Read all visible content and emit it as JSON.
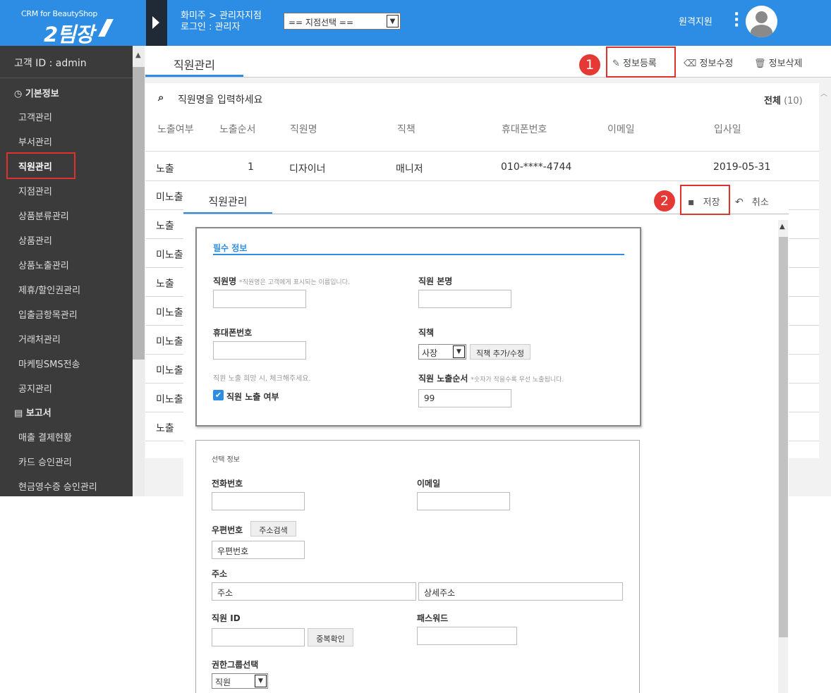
{
  "header": {
    "logo_top": "CRM for BeautyShop",
    "logo_main": "2팀장",
    "shop_line1": "화미주 > 관리자지점",
    "shop_line2": "로그인 : 관리자",
    "branch_select": "== 지점선택 ==",
    "remote_support": "원격지원"
  },
  "sidebar": {
    "customer_id": "고객 ID : admin",
    "sections": [
      {
        "title": "기본정보",
        "items": [
          "고객관리",
          "부서관리",
          "직원관리",
          "지점관리",
          "상품분류관리",
          "상품관리",
          "상품노출관리",
          "제휴/할인권관리",
          "입출금항목관리",
          "거래처관리",
          "마케팅SMS전송",
          "공지관리"
        ]
      },
      {
        "title": "보고서",
        "items": [
          "매출 결제현황",
          "카드 승인관리",
          "현금영수증 승인관리"
        ]
      }
    ],
    "active_item": "직원관리"
  },
  "main": {
    "tab": "직원관리",
    "toolbar": {
      "register": "정보등록",
      "edit": "정보수정",
      "delete": "정보삭제"
    },
    "search_placeholder": "직원명을 입력하세요",
    "total_label": "전체",
    "total_count": "(10)",
    "columns": [
      "노출여부",
      "노출순서",
      "직원명",
      "직책",
      "휴대폰번호",
      "이메일",
      "입사일"
    ],
    "first_row": {
      "exposure": "노출",
      "order": "1",
      "name": "디자이너",
      "position": "매니저",
      "phone": "010-****-4744",
      "email": "",
      "joined": "2019-05-31"
    },
    "exposure_column": [
      "미노출",
      "노출",
      "미노출",
      "노출",
      "미노출",
      "미노출",
      "미노출",
      "미노출",
      "노출"
    ]
  },
  "modal": {
    "tab": "직원관리",
    "save": "저장",
    "cancel": "취소",
    "required": {
      "title": "필수 정보",
      "name_label": "직원명",
      "name_hint": "*직원명은 고객에게 표시되는 이름입니다.",
      "realname_label": "직원 본명",
      "phone_label": "휴대폰번호",
      "position_label": "직책",
      "position_value": "사장",
      "position_btn": "직책 추가/수정",
      "expose_hint": "직원 노출 희망 시, 체크해주세요.",
      "expose_label": "직원 노출 여부",
      "order_label": "직원 노출순서",
      "order_hint": "*숫자가 작을수록 우선 노출됩니다.",
      "order_value": "99"
    },
    "optional": {
      "title": "선택 정보",
      "tel_label": "전화번호",
      "email_label": "이메일",
      "zip_label": "우편번호",
      "zip_btn": "주소검색",
      "zip_placeholder": "우편번호",
      "addr_label": "주소",
      "addr_placeholder": "주소",
      "addr_detail_placeholder": "상세주소",
      "id_label": "직원 ID",
      "id_btn": "중복확인",
      "pw_label": "패스워드",
      "group_label": "권한그룹선택",
      "group_value": "직원"
    }
  },
  "annotations": {
    "step1": "1",
    "step2": "2"
  },
  "colors": {
    "primary": "#2d8de4",
    "sidebar": "#3b3b3b",
    "highlight": "#e0322d"
  }
}
